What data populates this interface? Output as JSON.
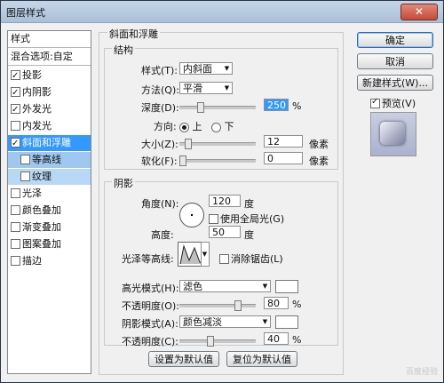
{
  "window": {
    "title": "图层样式",
    "close_label": "✕"
  },
  "left": {
    "header": "样式",
    "blend": "混合选项:自定",
    "items": [
      {
        "label": "投影",
        "checked": true
      },
      {
        "label": "内阴影",
        "checked": true
      },
      {
        "label": "外发光",
        "checked": true
      },
      {
        "label": "内发光",
        "checked": false
      },
      {
        "label": "斜面和浮雕",
        "checked": true,
        "selected": true
      },
      {
        "label": "等高线",
        "checked": false,
        "sub": true
      },
      {
        "label": "纹理",
        "checked": false,
        "sub": true
      },
      {
        "label": "光泽",
        "checked": false
      },
      {
        "label": "颜色叠加",
        "checked": false
      },
      {
        "label": "渐变叠加",
        "checked": false
      },
      {
        "label": "图案叠加",
        "checked": false
      },
      {
        "label": "描边",
        "checked": false
      }
    ]
  },
  "bevel": {
    "title": "斜面和浮雕",
    "structure": {
      "title": "结构",
      "style_label": "样式(T):",
      "style_value": "内斜面",
      "method_label": "方法(Q):",
      "method_value": "平滑",
      "depth_label": "深度(D):",
      "depth_value": "250",
      "depth_unit": "%",
      "depth_level": 0.25,
      "direction_label": "方向:",
      "dir_up": "上",
      "dir_down": "下",
      "size_label": "大小(Z):",
      "size_value": "12",
      "size_unit": "像素",
      "size_level": 0.08,
      "soften_label": "软化(F):",
      "soften_value": "0",
      "soften_unit": "像素",
      "soften_level": 0.0
    },
    "shading": {
      "title": "阴影",
      "angle_label": "角度(N):",
      "angle_value": "120",
      "angle_unit": "度",
      "global_light": "使用全局光(G)",
      "altitude_label": "高度:",
      "altitude_value": "50",
      "altitude_unit": "度",
      "gloss_label": "光泽等高线:",
      "antialias": "消除锯齿(L)",
      "highlight_label": "高光模式(H):",
      "highlight_value": "滤色",
      "highlight_opacity_label": "不透明度(O):",
      "highlight_opacity_value": "80",
      "highlight_opacity_unit": "%",
      "highlight_level": 0.8,
      "shadow_label": "阴影模式(A):",
      "shadow_value": "颜色减淡",
      "shadow_opacity_label": "不透明度(C):",
      "shadow_opacity_value": "40",
      "shadow_opacity_unit": "%",
      "shadow_level": 0.4
    },
    "set_default": "设置为默认值",
    "reset_default": "复位为默认值"
  },
  "buttons": {
    "ok": "确定",
    "cancel": "取消",
    "new_style": "新建样式(W)...",
    "preview": "预览(V)"
  },
  "watermark": "百度经验"
}
